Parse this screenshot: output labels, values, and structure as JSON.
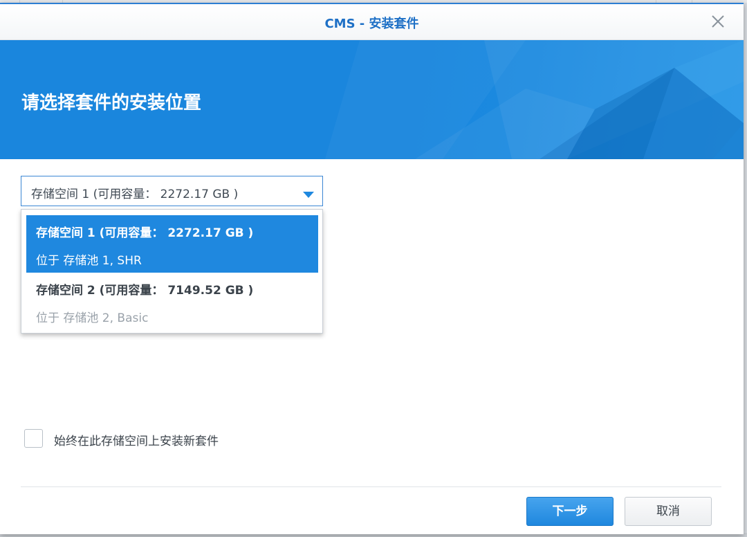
{
  "window": {
    "title": "CMS - 安装套件"
  },
  "banner": {
    "heading": "请选择套件的安装位置"
  },
  "volume_select": {
    "value": "存储空间 1 (可用容量： 2272.17 GB )",
    "options": [
      {
        "name": "存储空间 1 (可用容量： 2272.17 GB )",
        "location": "位于 存储池 1, SHR",
        "selected": true
      },
      {
        "name": "存储空间 2 (可用容量： 7149.52 GB )",
        "location": "位于 存储池 2, Basic",
        "selected": false
      }
    ]
  },
  "always_install": {
    "label": "始终在此存储空间上安装新套件",
    "checked": false
  },
  "footer": {
    "next_label": "下一步",
    "cancel_label": "取消"
  },
  "icons": {
    "close": "close-icon",
    "dropdown": "caret-down-icon"
  },
  "colors": {
    "accent": "#1f88df",
    "title": "#1e70c6",
    "banner": "#1a86dd"
  }
}
